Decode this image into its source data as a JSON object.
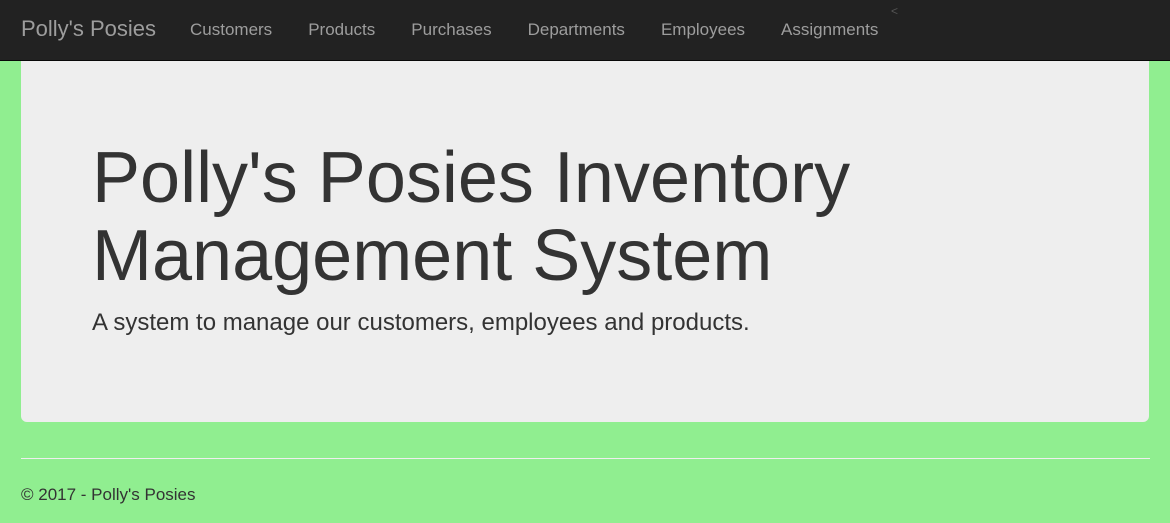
{
  "navbar": {
    "brand": "Polly's Posies",
    "links": [
      {
        "label": "Customers"
      },
      {
        "label": "Products"
      },
      {
        "label": "Purchases"
      },
      {
        "label": "Departments"
      },
      {
        "label": "Employees"
      },
      {
        "label": "Assignments"
      }
    ],
    "stray_glyph": "<"
  },
  "jumbotron": {
    "title": "Polly's Posies Inventory Management System",
    "lead": "A system to manage our customers, employees and products."
  },
  "footer": {
    "copyright": "© 2017 - Polly's Posies"
  },
  "colors": {
    "page_background": "#90ee90",
    "navbar_background": "#222222",
    "navbar_text": "#9d9d9d",
    "jumbotron_background": "#eeeeee",
    "body_text": "#333333"
  }
}
